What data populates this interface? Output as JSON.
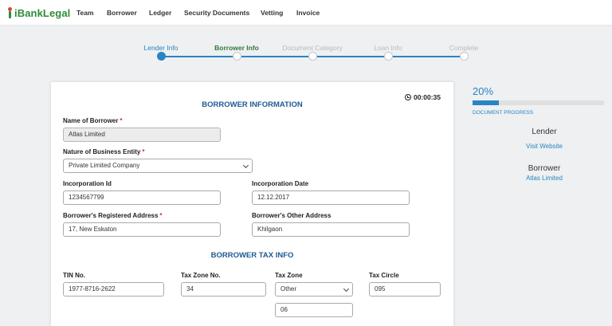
{
  "app": {
    "logo_text": "iBankLegal"
  },
  "nav": {
    "items": [
      "Team",
      "Borrower",
      "Ledger",
      "Security Documents",
      "Vetting",
      "Invoice"
    ]
  },
  "stepper": {
    "steps": [
      "Lender Info",
      "Borrower Info",
      "Document Category",
      "Loan Info",
      "Complete"
    ]
  },
  "form": {
    "timer": "00:00:35",
    "title": "BORROWER INFORMATION",
    "required_mark": "*",
    "name_of_borrower": {
      "label": "Name of Borrower",
      "value": "Atlas Limited"
    },
    "nature_of_business": {
      "label": "Nature of Business Entity",
      "value": "Private Limited Company"
    },
    "incorporation_id": {
      "label": "Incorporation Id",
      "value": "1234567799"
    },
    "incorporation_date": {
      "label": "Incorporation Date",
      "value": "12.12.2017"
    },
    "registered_address": {
      "label": "Borrower's Registered Address",
      "value": "17, New Eskaton"
    },
    "other_address": {
      "label": "Borrower's Other Address",
      "value": "Khilgaon"
    },
    "tax_title": "BORROWER TAX INFO",
    "tin": {
      "label": "TIN No.",
      "value": "1977-8716-2622"
    },
    "tax_zone_no": {
      "label": "Tax Zone No.",
      "value": "34"
    },
    "tax_zone": {
      "label": "Tax Zone",
      "value": "Other",
      "other_value": "06"
    },
    "tax_circle": {
      "label": "Tax Circle",
      "value": "095"
    }
  },
  "sidebar": {
    "progress_percent_text": "20%",
    "progress_fraction": 0.2,
    "progress_label": "DOCUMENT PROGRESS",
    "lender_heading": "Lender",
    "lender_link": "Visit Website",
    "borrower_heading": "Borrower",
    "borrower_link": "Atlas Limited"
  },
  "colors": {
    "accent": "#2a84c6",
    "brand": "#2e8b3a",
    "section_title": "#1e5a92",
    "required": "#d32f2f"
  }
}
